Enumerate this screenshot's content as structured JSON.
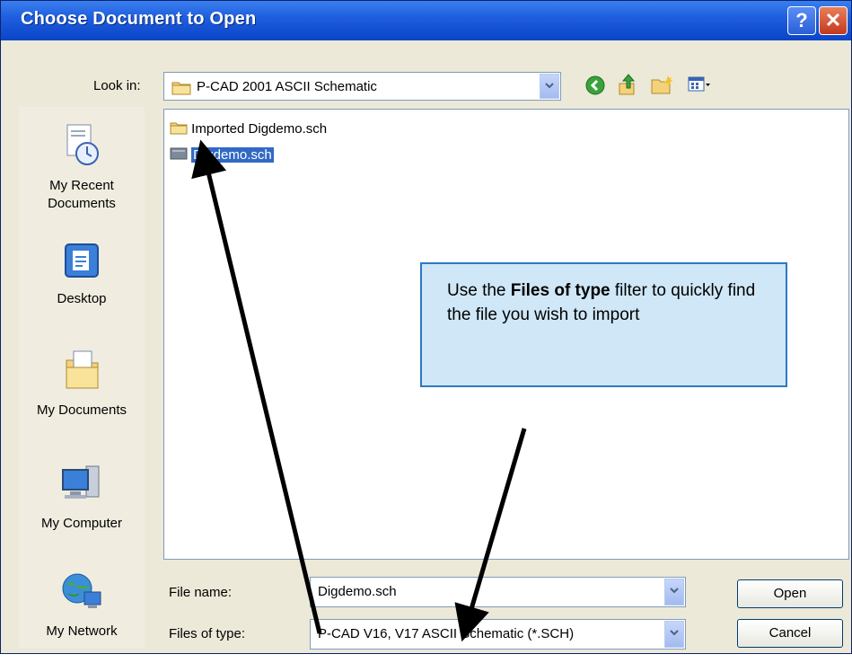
{
  "window": {
    "title": "Choose Document to Open",
    "help_glyph": "?",
    "close_glyph": "✕"
  },
  "toolbar": {
    "look_in_label": "Look in:",
    "look_in_value": "P-CAD 2001 ASCII Schematic",
    "icons": [
      "back-icon",
      "up-folder-icon",
      "new-folder-icon",
      "views-menu-icon"
    ]
  },
  "places": [
    {
      "label": "My Recent Documents",
      "icon": "recent-documents-icon"
    },
    {
      "label": "Desktop",
      "icon": "desktop-icon"
    },
    {
      "label": "My Documents",
      "icon": "my-documents-icon"
    },
    {
      "label": "My Computer",
      "icon": "my-computer-icon"
    },
    {
      "label": "My Network",
      "icon": "my-network-icon"
    }
  ],
  "files": [
    {
      "name": "Imported Digdemo.sch",
      "icon": "folder-icon",
      "selected": false
    },
    {
      "name": "Digdemo.sch",
      "icon": "schematic-file-icon",
      "selected": true
    }
  ],
  "file_name": {
    "label": "File name:",
    "value": "Digdemo.sch"
  },
  "file_type": {
    "label": "Files of type:",
    "value": "P-CAD V16, V17 ASCII Schematic (*.SCH)"
  },
  "buttons": {
    "open": "Open",
    "cancel": "Cancel"
  },
  "callout": {
    "prefix": "Use the ",
    "bold": "Files of type",
    "suffix": " filter to quickly find the file you wish to import"
  },
  "colors": {
    "titlebar": "#0a45c8",
    "selection": "#316ac5",
    "callout_fill": "#cfe7f7",
    "callout_border": "#2d79c2"
  }
}
